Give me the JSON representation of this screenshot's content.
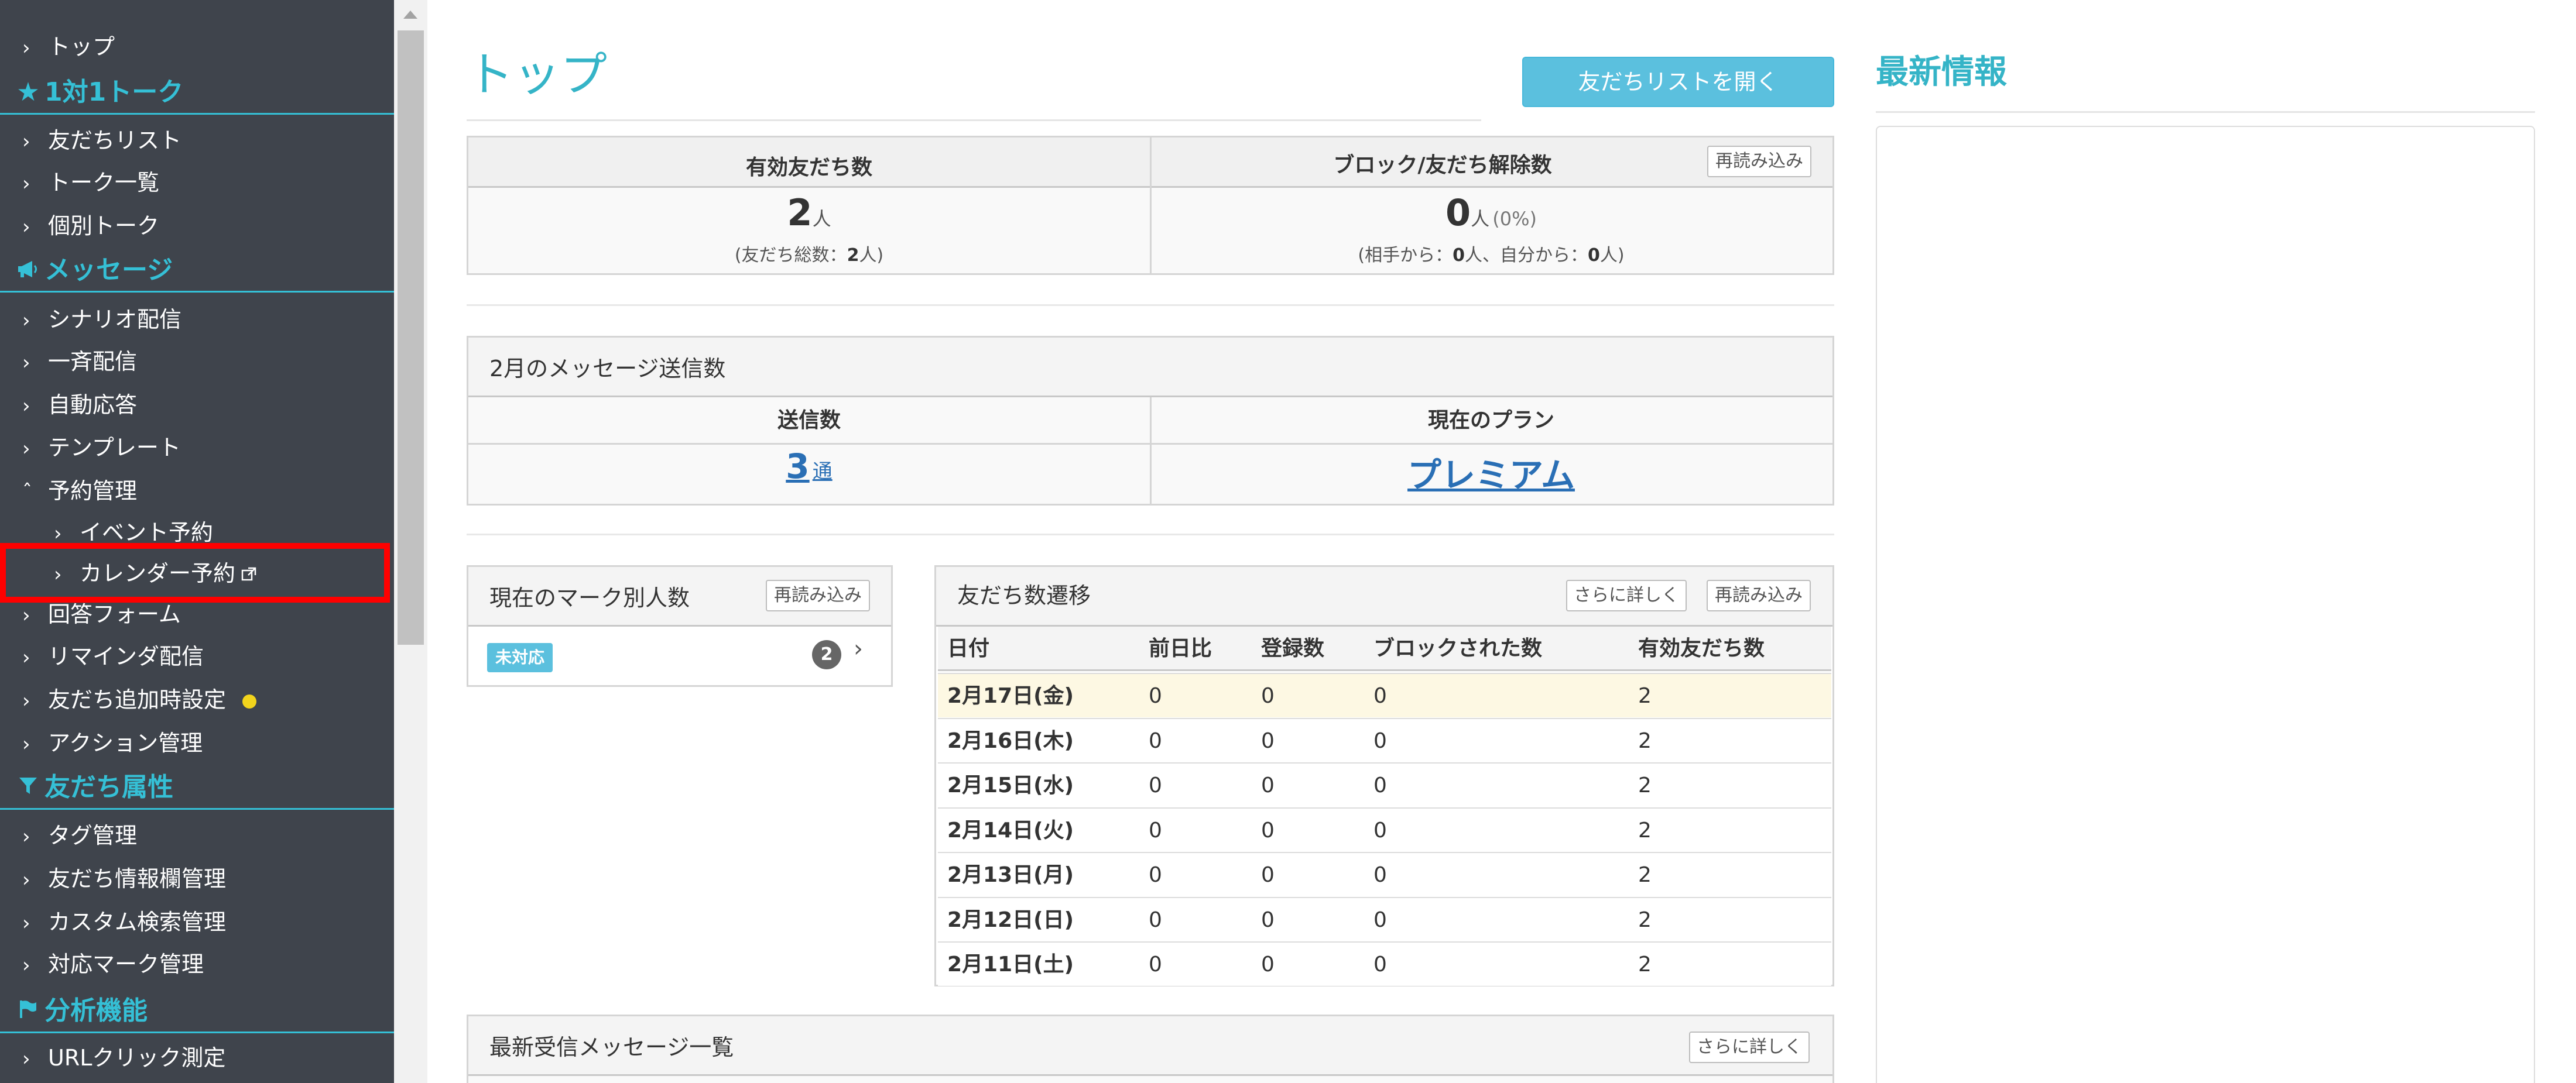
{
  "sidebar": {
    "items": [
      {
        "label": "トップ"
      },
      {
        "label": "友だちリスト"
      },
      {
        "label": "トーク一覧"
      },
      {
        "label": "個別トーク"
      },
      {
        "label": "シナリオ配信"
      },
      {
        "label": "一斉配信"
      },
      {
        "label": "自動応答"
      },
      {
        "label": "テンプレート"
      },
      {
        "label": "予約管理"
      },
      {
        "label": "イベント予約"
      },
      {
        "label": "カレンダー予約"
      },
      {
        "label": "回答フォーム"
      },
      {
        "label": "リマインダ配信"
      },
      {
        "label": "友だち追加時設定"
      },
      {
        "label": "アクション管理"
      },
      {
        "label": "タグ管理"
      },
      {
        "label": "友だち情報欄管理"
      },
      {
        "label": "カスタム検索管理"
      },
      {
        "label": "対応マーク管理"
      },
      {
        "label": "URLクリック測定"
      }
    ],
    "sections": [
      {
        "label": "1対1トーク",
        "icon": "star-icon"
      },
      {
        "label": "メッセージ",
        "icon": "megaphone-icon"
      },
      {
        "label": "友だち属性",
        "icon": "filter-icon"
      },
      {
        "label": "分析機能",
        "icon": "flag-icon"
      }
    ],
    "accent_color": "#35c0d6",
    "highlight_color": "#ff0000"
  },
  "main": {
    "title": "トップ",
    "open_list_button": "友だちリストを開く",
    "reload_label": "再読み込み",
    "detail_label": "さらに詳しく",
    "friends": {
      "active_label": "有効友だち数",
      "active_count": "2",
      "active_unit": "人",
      "total_prefix": "(友だち総数：",
      "total_count": "2",
      "total_suffix": "人)",
      "blocked_label": "ブロック/友だち解除数",
      "blocked_count": "0",
      "blocked_unit": "人",
      "blocked_pct": "(0%)",
      "blocked_from_other_prefix": "(相手から：",
      "blocked_from_other": "0",
      "blocked_from_self_prefix": "人、自分から：",
      "blocked_from_self": "0",
      "blocked_suffix": "人)"
    },
    "messages": {
      "title": "2月のメッセージ送信数",
      "sent_label": "送信数",
      "sent_count": "3",
      "sent_unit": "通",
      "plan_label": "現在のプラン",
      "plan_value": "プレミアム"
    },
    "marks": {
      "title": "現在のマーク別人数",
      "badge": "未対応",
      "count": "2"
    },
    "trend": {
      "title": "友だち数遷移",
      "columns": [
        "日付",
        "前日比",
        "登録数",
        "ブロックされた数",
        "有効友だち数"
      ],
      "rows": [
        [
          "2月17日(金)",
          "0",
          "0",
          "0",
          "2"
        ],
        [
          "2月16日(木)",
          "0",
          "0",
          "0",
          "2"
        ],
        [
          "2月15日(水)",
          "0",
          "0",
          "0",
          "2"
        ],
        [
          "2月14日(火)",
          "0",
          "0",
          "0",
          "2"
        ],
        [
          "2月13日(月)",
          "0",
          "0",
          "0",
          "2"
        ],
        [
          "2月12日(日)",
          "0",
          "0",
          "0",
          "2"
        ],
        [
          "2月11日(土)",
          "0",
          "0",
          "0",
          "2"
        ]
      ]
    },
    "latest_messages": {
      "title": "最新受信メッセージ一覧"
    }
  },
  "news": {
    "title": "最新情報"
  }
}
